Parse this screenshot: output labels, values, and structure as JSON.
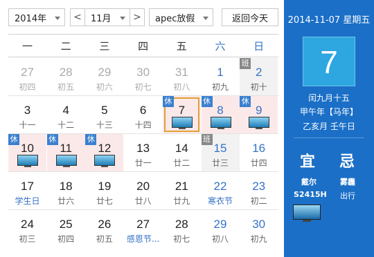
{
  "toolbar": {
    "year": "2014年",
    "prev": "<",
    "month": "11月",
    "next": ">",
    "holiday": "apec放假",
    "today_button": "返回今天"
  },
  "weekdays": [
    "一",
    "二",
    "三",
    "四",
    "五",
    "六",
    "日"
  ],
  "days": [
    {
      "d": "27",
      "l": "初四",
      "other": true
    },
    {
      "d": "28",
      "l": "初五",
      "other": true
    },
    {
      "d": "29",
      "l": "初六",
      "other": true
    },
    {
      "d": "30",
      "l": "初七",
      "other": true
    },
    {
      "d": "31",
      "l": "初八",
      "other": true
    },
    {
      "d": "1",
      "l": "初九",
      "we": true
    },
    {
      "d": "2",
      "l": "初十",
      "we": true,
      "tag": "班",
      "work": true
    },
    {
      "d": "3",
      "l": "十一"
    },
    {
      "d": "4",
      "l": "十二"
    },
    {
      "d": "5",
      "l": "十三"
    },
    {
      "d": "6",
      "l": "十四"
    },
    {
      "d": "7",
      "l": "",
      "tag": "休",
      "holiday": true,
      "today": true,
      "monitor": true
    },
    {
      "d": "8",
      "l": "",
      "we": true,
      "tag": "休",
      "holiday": true,
      "monitor": true
    },
    {
      "d": "9",
      "l": "",
      "we": true,
      "tag": "休",
      "holiday": true,
      "monitor": true
    },
    {
      "d": "10",
      "l": "",
      "tag": "休",
      "holiday": true,
      "monitor": true
    },
    {
      "d": "11",
      "l": "",
      "tag": "休",
      "holiday": true,
      "monitor": true
    },
    {
      "d": "12",
      "l": "",
      "tag": "休",
      "holiday": true,
      "monitor": true
    },
    {
      "d": "13",
      "l": "廿一"
    },
    {
      "d": "14",
      "l": "廿二"
    },
    {
      "d": "15",
      "l": "廿三",
      "we": true,
      "tag": "班",
      "work": true
    },
    {
      "d": "16",
      "l": "廿四",
      "we": true
    },
    {
      "d": "17",
      "l": "学生日",
      "festival": true
    },
    {
      "d": "18",
      "l": "廿六"
    },
    {
      "d": "19",
      "l": "廿七"
    },
    {
      "d": "20",
      "l": "廿八"
    },
    {
      "d": "21",
      "l": "廿九"
    },
    {
      "d": "22",
      "l": "寒衣节",
      "we": true,
      "festival": true
    },
    {
      "d": "23",
      "l": "初二",
      "we": true
    },
    {
      "d": "24",
      "l": "初三"
    },
    {
      "d": "25",
      "l": "初四"
    },
    {
      "d": "26",
      "l": "初五"
    },
    {
      "d": "27",
      "l": "感恩节...",
      "festival": true
    },
    {
      "d": "28",
      "l": "初七"
    },
    {
      "d": "29",
      "l": "初八",
      "we": true
    },
    {
      "d": "30",
      "l": "初九",
      "we": true
    }
  ],
  "side": {
    "date_title": "2014-11-07 星期五",
    "big_day": "7",
    "lunar_date": "闰九月十五",
    "ganzhi_year": "甲午年【马年】",
    "ganzhi_month_day": "乙亥月 壬午日",
    "yi_label": "宜",
    "ji_label": "忌",
    "yi_line1": "戴尔",
    "yi_line2": "S2415H",
    "ji_line1": "雾霾",
    "ji_line2": "出行"
  },
  "colors": {
    "side_bg": "#1b6fc7",
    "big_day_bg": "#2ea7e0",
    "weekend_text": "#3472c6",
    "holiday_bg": "#fbe9e9",
    "today_border": "#e0a133"
  }
}
